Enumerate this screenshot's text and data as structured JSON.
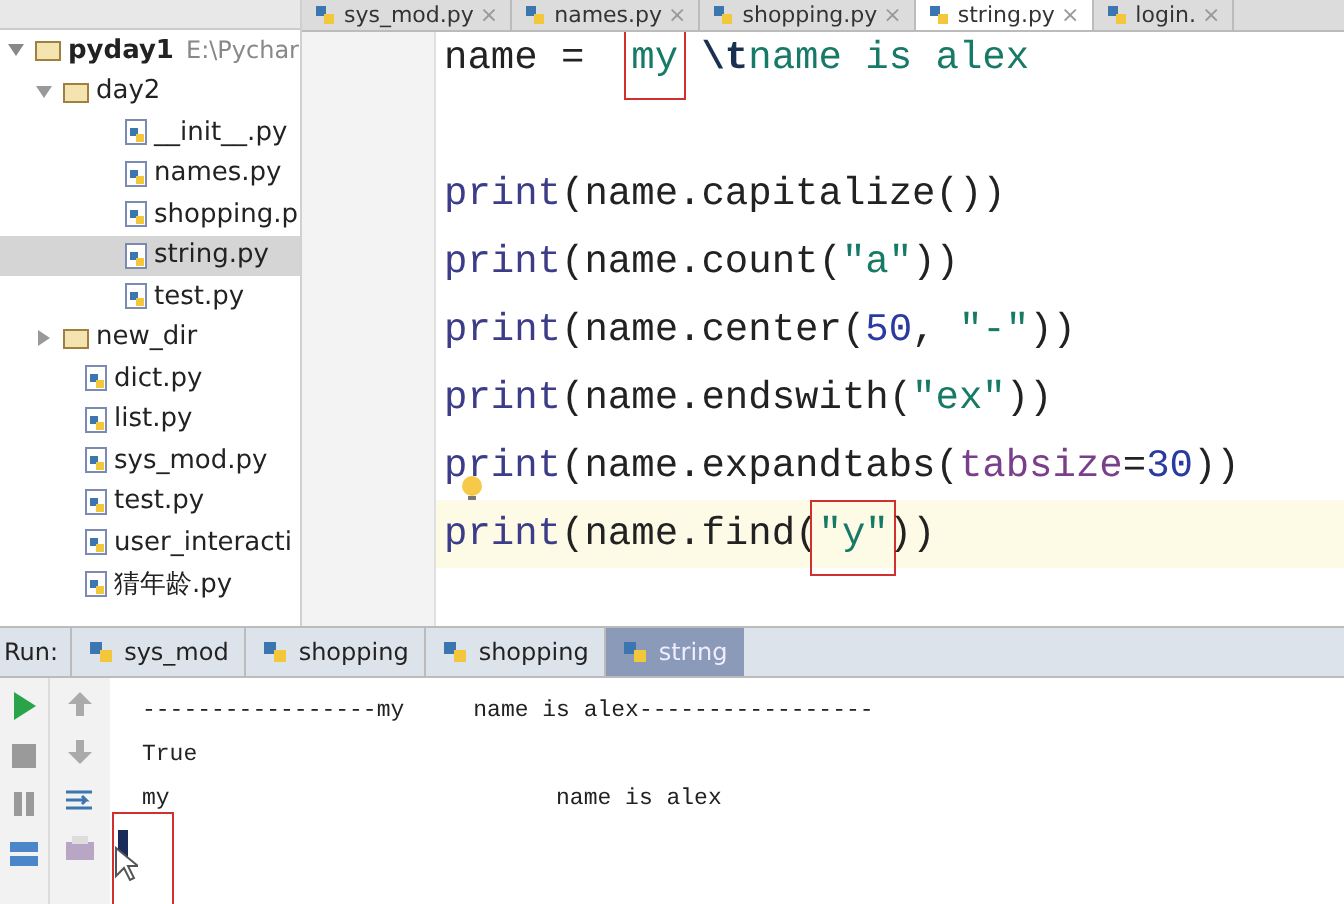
{
  "project_tree": [
    {
      "label": "pyday1",
      "path": "E:\\Pychar",
      "kind": "folder",
      "expanded": true,
      "selected": false,
      "children": [
        {
          "label": "day2",
          "kind": "folder",
          "expanded": true,
          "selected": false,
          "children": [
            {
              "label": "__init__.py",
              "kind": "file",
              "selected": false
            },
            {
              "label": "names.py",
              "kind": "file",
              "selected": false
            },
            {
              "label": "shopping.p",
              "kind": "file",
              "selected": false
            },
            {
              "label": "string.py",
              "kind": "file",
              "selected": true
            },
            {
              "label": "test.py",
              "kind": "file",
              "selected": false
            }
          ]
        },
        {
          "label": "new_dir",
          "kind": "folder",
          "expanded": false,
          "selected": false
        },
        {
          "label": "dict.py",
          "kind": "file",
          "selected": false
        },
        {
          "label": "list.py",
          "kind": "file",
          "selected": false
        },
        {
          "label": "sys_mod.py",
          "kind": "file",
          "selected": false
        },
        {
          "label": "test.py",
          "kind": "file",
          "selected": false
        },
        {
          "label": "user_interacti",
          "kind": "file",
          "selected": false
        },
        {
          "label": "猜年龄.py",
          "kind": "file",
          "selected": false
        }
      ]
    }
  ],
  "editor_tabs": [
    {
      "label": "sys_mod.py",
      "close": "×",
      "selected": false
    },
    {
      "label": "names.py",
      "close": "×",
      "selected": false
    },
    {
      "label": "shopping.py",
      "close": "×",
      "selected": false
    },
    {
      "label": "string.py",
      "close": "×",
      "selected": true
    },
    {
      "label": "login.",
      "close": "×",
      "selected": false
    }
  ],
  "code_lines": [
    {
      "current": false,
      "tokens": [
        {
          "kind": "plain",
          "text": "name =  "
        },
        {
          "kind": "string",
          "text": "my",
          "boxed": true
        },
        {
          "kind": "escape",
          "text": " \\t"
        },
        {
          "kind": "string",
          "text": "name is alex"
        }
      ]
    },
    {
      "current": false
    },
    {
      "current": false,
      "tokens": [
        {
          "kind": "builtin",
          "text": "print"
        },
        {
          "kind": "plain",
          "text": "(name.capitalize())"
        }
      ]
    },
    {
      "current": false,
      "tokens": [
        {
          "kind": "builtin",
          "text": "print"
        },
        {
          "kind": "plain",
          "text": "(name.count("
        },
        {
          "kind": "string",
          "text": "\"a\""
        },
        {
          "kind": "plain",
          "text": "))"
        }
      ]
    },
    {
      "current": false,
      "tokens": [
        {
          "kind": "builtin",
          "text": "print"
        },
        {
          "kind": "plain",
          "text": "(name.center("
        },
        {
          "kind": "number",
          "text": "50"
        },
        {
          "kind": "plain",
          "text": ", "
        },
        {
          "kind": "string",
          "text": "\"-\""
        },
        {
          "kind": "plain",
          "text": "))"
        }
      ]
    },
    {
      "current": false,
      "tokens": [
        {
          "kind": "builtin",
          "text": "print"
        },
        {
          "kind": "plain",
          "text": "(name.endswith("
        },
        {
          "kind": "string",
          "text": "\"ex\""
        },
        {
          "kind": "plain",
          "text": "))"
        }
      ]
    },
    {
      "current": false,
      "bulb": true,
      "tokens": [
        {
          "kind": "builtin",
          "text": "print"
        },
        {
          "kind": "plain",
          "text": "(name.expandtabs("
        },
        {
          "kind": "param",
          "text": "tabsize"
        },
        {
          "kind": "plain",
          "text": "="
        },
        {
          "kind": "number",
          "text": "30"
        },
        {
          "kind": "plain",
          "text": "))"
        }
      ]
    },
    {
      "current": true,
      "tokens": [
        {
          "kind": "builtin",
          "text": "print"
        },
        {
          "kind": "plain",
          "text": "(name.find("
        },
        {
          "kind": "string",
          "text": "\"y\"",
          "boxed": true
        },
        {
          "kind": "plain",
          "text": "))"
        }
      ]
    }
  ],
  "run_panel": {
    "label": "Run:",
    "tabs": [
      {
        "label": "sys_mod",
        "selected": false
      },
      {
        "label": "shopping",
        "selected": false
      },
      {
        "label": "shopping",
        "selected": false
      },
      {
        "label": "string",
        "selected": true
      }
    ],
    "output": [
      "-----------------my \tname is alex-----------------",
      "True",
      "my                            name is alex"
    ],
    "cursor_boxed": true
  }
}
